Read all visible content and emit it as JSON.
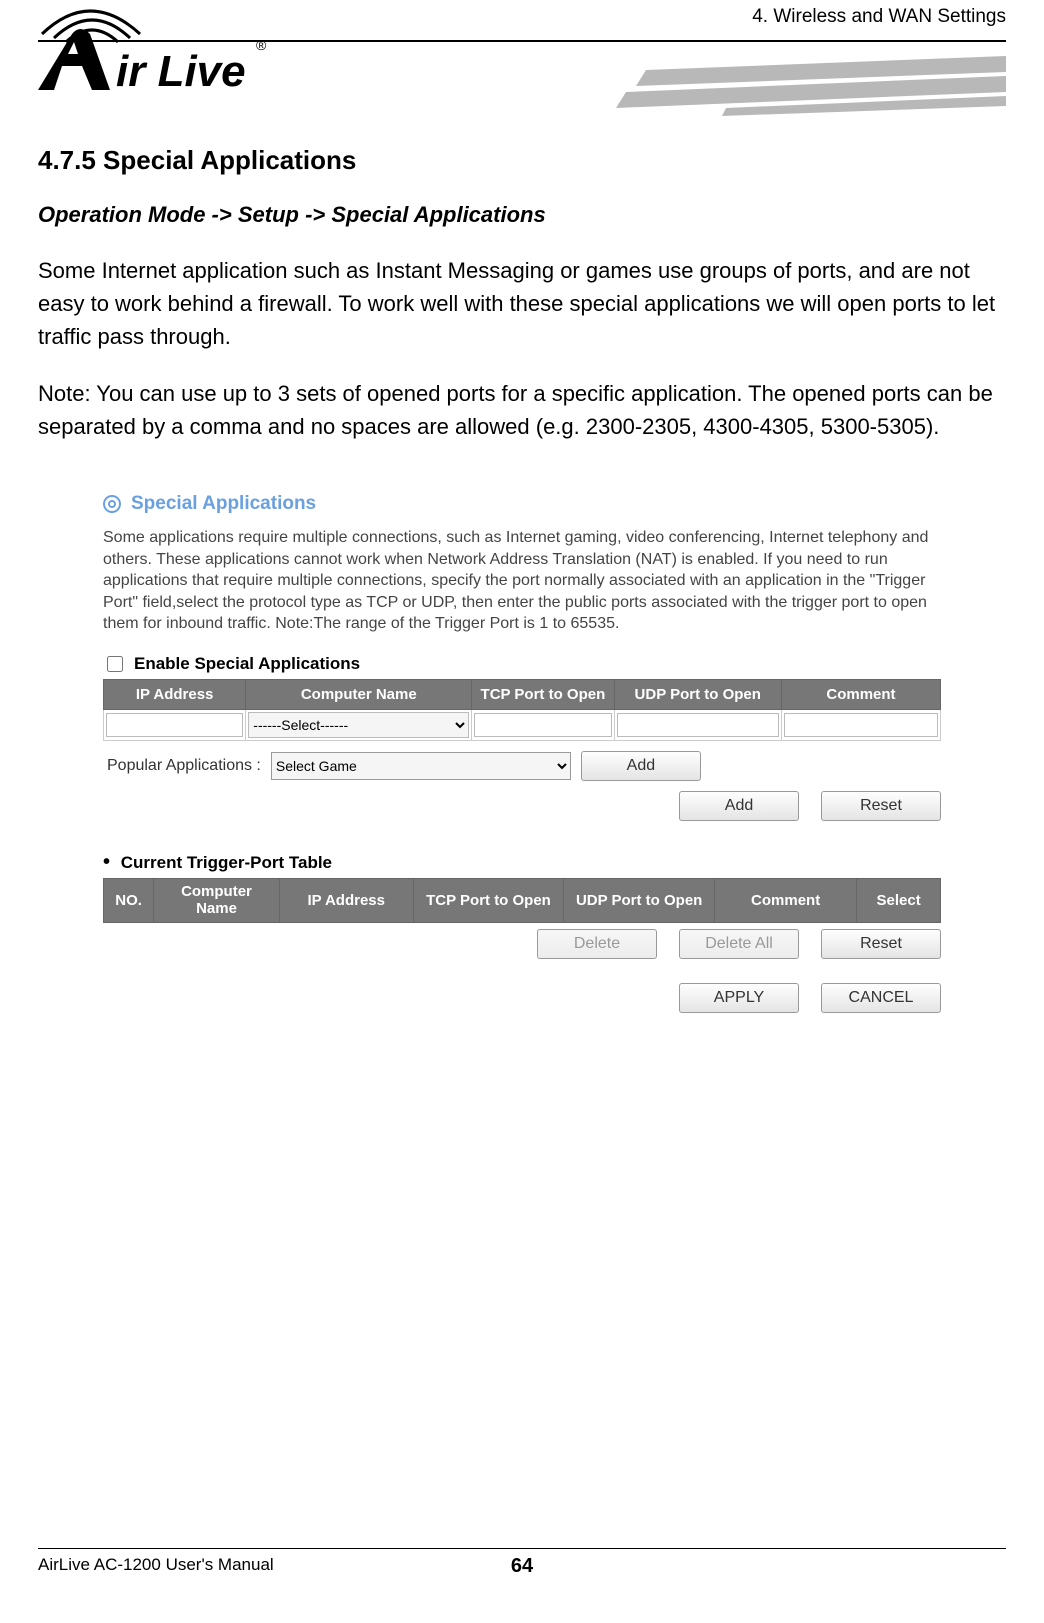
{
  "header": {
    "chapter": "4. Wireless and WAN Settings",
    "logo_brand": "Air Live"
  },
  "section": {
    "number_title": "4.7.5 Special Applications",
    "nav_path": "Operation Mode -> Setup -> Special Applications",
    "paragraph": "Some Internet application such as Instant Messaging or games use groups of ports, and are not easy to work behind a firewall. To work well with these special applications we will open ports to let traffic pass through.",
    "note": "Note: You can use up to 3 sets of opened ports for a specific application. The opened ports can be separated by a comma and no spaces are allowed (e.g. 2300-2305, 4300-4305, 5300-5305)."
  },
  "panel": {
    "title": "Special Applications",
    "description": "Some applications require multiple connections, such as Internet gaming, video conferencing, Internet telephony and others. These applications cannot work when Network Address Translation (NAT) is enabled. If you need to run applications that require multiple connections, specify the port normally associated with an application in the \"Trigger Port\" field,select the protocol type as TCP or UDP, then enter the public ports associated with the trigger port to open them for inbound traffic. Note:The range of the Trigger Port is 1 to 65535.",
    "enable_label": "Enable Special Applications",
    "table": {
      "headers": {
        "ip": "IP Address",
        "computer": "Computer Name",
        "tcp": "TCP Port to Open",
        "udp": "UDP Port to Open",
        "comment": "Comment"
      },
      "select_placeholder": "------Select------"
    },
    "popular": {
      "label": "Popular Applications :",
      "select_value": "Select Game",
      "add_button": "Add"
    },
    "buttons": {
      "add": "Add",
      "reset": "Reset"
    },
    "trigger": {
      "title": "Current Trigger-Port Table",
      "headers": {
        "no": "NO.",
        "computer": "Computer Name",
        "ip": "IP Address",
        "tcp": "TCP Port to Open",
        "udp": "UDP Port to Open",
        "comment": "Comment",
        "select": "Select"
      },
      "buttons": {
        "delete": "Delete",
        "delete_all": "Delete All",
        "reset": "Reset"
      }
    },
    "final_buttons": {
      "apply": "APPLY",
      "cancel": "CANCEL"
    }
  },
  "footer": {
    "manual": "AirLive AC-1200 User's Manual",
    "page": "64"
  }
}
